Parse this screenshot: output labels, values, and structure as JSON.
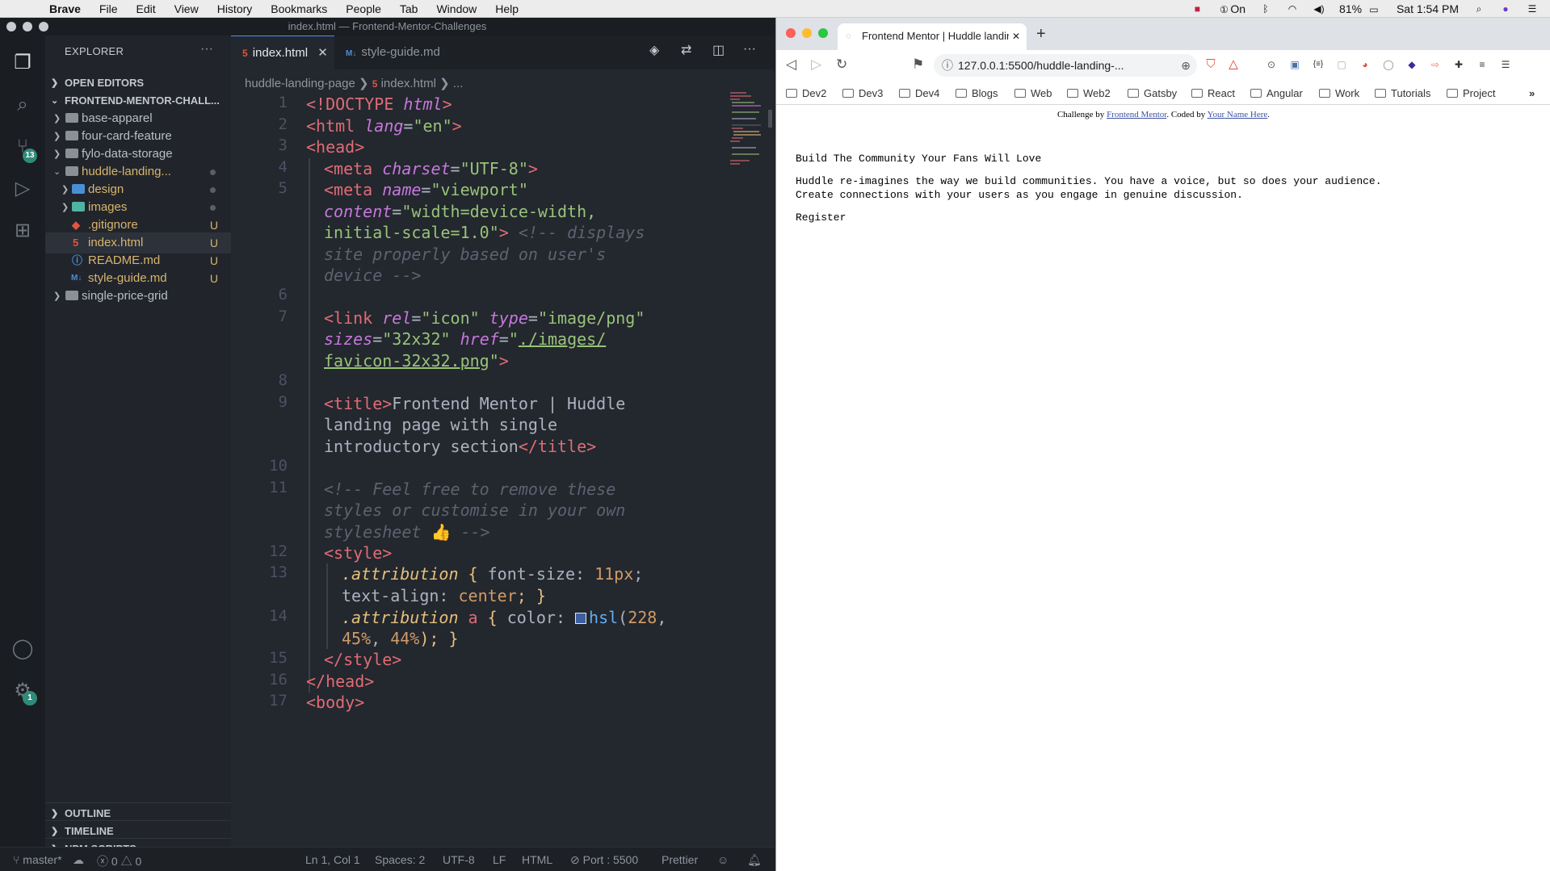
{
  "menubar": {
    "app": "Brave",
    "items": [
      "File",
      "Edit",
      "View",
      "History",
      "Bookmarks",
      "People",
      "Tab",
      "Window",
      "Help"
    ],
    "right": {
      "vpn": "On",
      "battery": "81%",
      "clock": "Sat 1:54 PM"
    }
  },
  "vscode": {
    "window_title": "index.html — Frontend-Mentor-Challenges",
    "explorer_title": "EXPLORER",
    "sections": {
      "open_editors": "OPEN EDITORS",
      "workspace": "FRONTEND-MENTOR-CHALL...",
      "outline": "OUTLINE",
      "timeline": "TIMELINE",
      "npm": "NPM SCRIPTS"
    },
    "activity_badges": {
      "scm": "13",
      "settings": "1"
    },
    "tree": [
      {
        "label": "base-apparel",
        "kind": "folder"
      },
      {
        "label": "four-card-feature",
        "kind": "folder"
      },
      {
        "label": "fylo-data-storage",
        "kind": "folder"
      },
      {
        "label": "huddle-landing...",
        "kind": "folder-open"
      },
      {
        "label": "design",
        "kind": "folder"
      },
      {
        "label": "images",
        "kind": "folder"
      },
      {
        "label": ".gitignore",
        "kind": "file",
        "status": "U"
      },
      {
        "label": "index.html",
        "kind": "file",
        "status": "U"
      },
      {
        "label": "README.md",
        "kind": "file",
        "status": "U"
      },
      {
        "label": "style-guide.md",
        "kind": "file",
        "status": "U"
      },
      {
        "label": "single-price-grid",
        "kind": "folder"
      }
    ],
    "tabs": [
      {
        "label": "index.html",
        "icon": "html-file-icon",
        "active": true
      },
      {
        "label": "style-guide.md",
        "icon": "markdown-file-icon",
        "active": false
      }
    ],
    "breadcrumb": {
      "folder": "huddle-landing-page",
      "file": "index.html",
      "tail": "..."
    },
    "line_numbers": [
      "1",
      "2",
      "3",
      "4",
      "5",
      "6",
      "7",
      "8",
      "9",
      "10",
      "11",
      "12",
      "13",
      "14",
      "15",
      "16",
      "17"
    ],
    "code": {
      "l1_a": "<!DOCTYPE ",
      "l1_b": "html",
      "l1_c": ">",
      "l2_a": "<html ",
      "l2_b": "lang",
      "l2_c": "=",
      "l2_d": "\"en\"",
      "l2_e": ">",
      "l3": "<head>",
      "l4_a": "<meta ",
      "l4_b": "charset",
      "l4_c": "=",
      "l4_d": "\"UTF-8\"",
      "l4_e": ">",
      "l5_a": "<meta ",
      "l5_b": "name",
      "l5_c": "=",
      "l5_d": "\"viewport\"",
      "l5w_a": "content",
      "l5w_b": "=",
      "l5w_c": "\"width=device-width,",
      "l5w2_a": "initial-scale=1.0\"",
      "l5w2_b": ">",
      "l5w2_c": " <!-- displays",
      "l5w3": "site properly based on user's",
      "l5w4": "device -->",
      "l7_a": "<link ",
      "l7_b": "rel",
      "l7_c": "=",
      "l7_d": "\"icon\"",
      "l7_e": " ",
      "l7_f": "type",
      "l7_g": "=",
      "l7_h": "\"image/png\"",
      "l7w_a": "sizes",
      "l7w_b": "=",
      "l7w_c": "\"32x32\"",
      "l7w_d": " ",
      "l7w_e": "href",
      "l7w_f": "=",
      "l7w_g": "\"",
      "l7w_h": "./images/",
      "l7w2_a": "favicon-32x32.png",
      "l7w2_b": "\"",
      "l7w2_c": ">",
      "l9_a": "<title>",
      "l9_b": "Frontend Mentor | Huddle",
      "l9w": "landing page with single",
      "l9w2_a": "introductory section",
      "l9w2_b": "</title>",
      "l11": "<!-- Feel free to remove these",
      "l11w": "styles or customise in your own",
      "l11w2_a": "stylesheet ",
      "l11w2_b": "👍",
      "l11w2_c": " -->",
      "l12": "<style>",
      "l13_a": ".attribution",
      "l13_b": " { ",
      "l13_c": "font-size",
      "l13_d": ": ",
      "l13_e": "11px",
      "l13_f": ";",
      "l13w_a": "text-align",
      "l13w_b": ": ",
      "l13w_c": "center",
      "l13w_d": "; }",
      "l14_a": ".attribution",
      "l14_b": " a",
      "l14_c": " { ",
      "l14_d": "color",
      "l14_e": ": ",
      "l14_f": "hsl",
      "l14_g": "(",
      "l14_h": "228",
      "l14_i": ",",
      "l14w_a": "45%",
      "l14w_b": ", ",
      "l14w_c": "44%",
      "l14w_d": "); }",
      "l15": "</style>",
      "l16": "</head>",
      "l17": "<body>"
    },
    "swatch_color": "#3d5fa2",
    "status": {
      "branch": "master*",
      "errors": "0",
      "warnings": "0",
      "position": "Ln 1, Col 1",
      "spaces": "Spaces: 2",
      "encoding": "UTF-8",
      "eol": "LF",
      "language": "HTML",
      "port": "Port : 5500",
      "formatter": "Prettier"
    }
  },
  "browser": {
    "tab_title": "Frontend Mentor | Huddle landin",
    "url": "127.0.0.1:5500/huddle-landing-...",
    "bookmarks": [
      "Dev2",
      "Dev3",
      "Dev4",
      "Blogs",
      "Web",
      "Web2",
      "Gatsby",
      "React",
      "Angular",
      "Work",
      "Tutorials",
      "Project"
    ],
    "page": {
      "attribution_prefix": "Challenge by ",
      "attribution_link1": "Frontend Mentor",
      "attribution_mid": ". Coded by ",
      "attribution_link2": "Your Name Here",
      "attribution_suffix": ".",
      "heading": "Build The Community Your Fans Will Love",
      "para_line1": "Huddle re-imagines the way we build communities. You have a voice, but so does your audience.",
      "para_line2": "Create connections with your users as you engage in genuine discussion.",
      "register": "Register"
    }
  }
}
